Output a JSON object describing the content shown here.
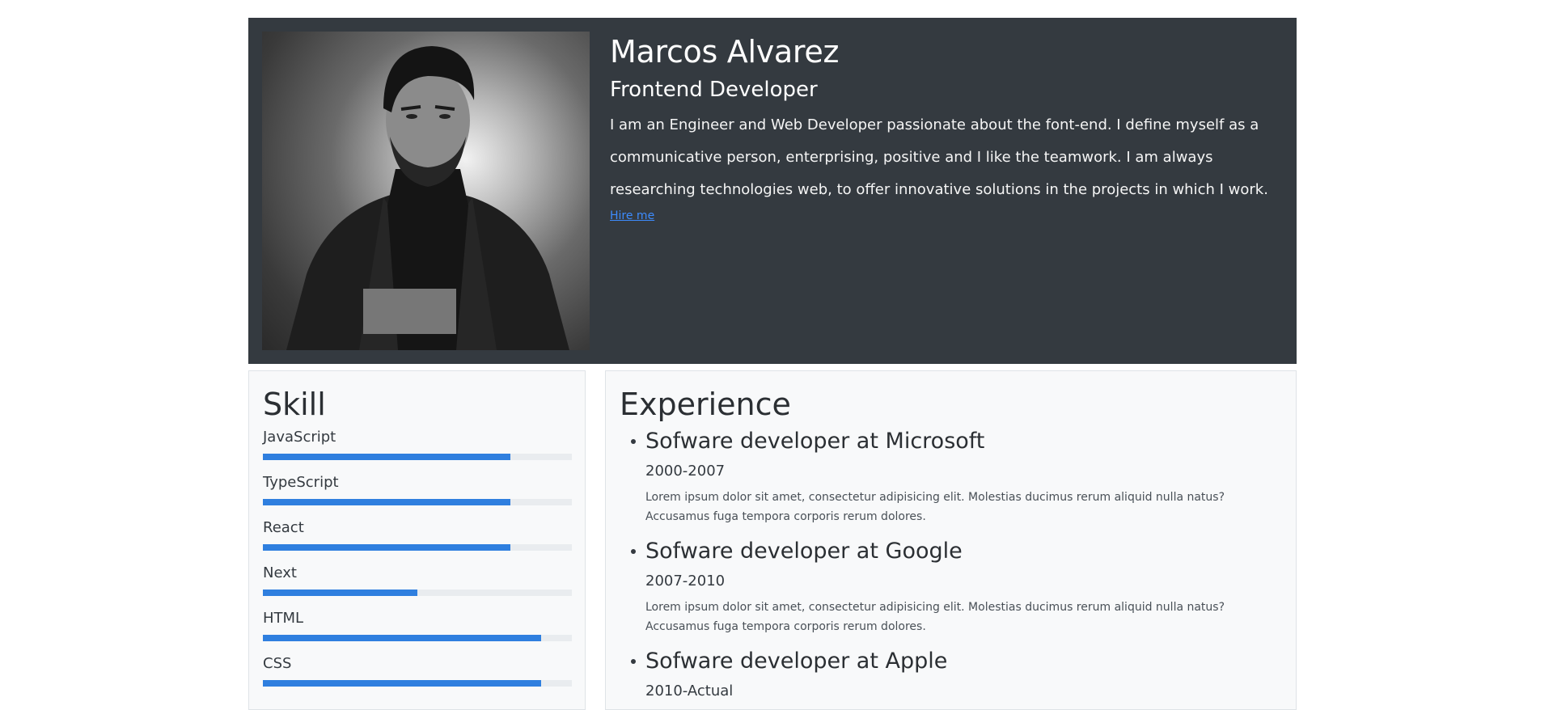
{
  "profile": {
    "name": "Marcos Alvarez",
    "role": "Frontend Developer",
    "bio": "I am an Engineer and Web Developer passionate about the font-end. I define myself as a communicative person, enterprising, positive and I like the teamwork. I am always researching technologies web, to offer innovative solutions in the projects in which I work.",
    "hire_label": "Hire me",
    "photo_alt": "Portrait photo"
  },
  "skills": {
    "title": "Skill",
    "items": [
      {
        "label": "JavaScript",
        "level": 0.8
      },
      {
        "label": "TypeScript",
        "level": 0.8
      },
      {
        "label": "React",
        "level": 0.8
      },
      {
        "label": "Next",
        "level": 0.5
      },
      {
        "label": "HTML",
        "level": 0.9
      },
      {
        "label": "CSS",
        "level": 0.9
      }
    ]
  },
  "experience": {
    "title": "Experience",
    "items": [
      {
        "title": "Sofware developer at Microsoft",
        "years": "2000-2007",
        "desc": "Lorem ipsum dolor sit amet, consectetur adipisicing elit. Molestias ducimus rerum aliquid nulla natus? Accusamus fuga tempora corporis rerum dolores."
      },
      {
        "title": "Sofware developer at Google",
        "years": "2007-2010",
        "desc": "Lorem ipsum dolor sit amet, consectetur adipisicing elit. Molestias ducimus rerum aliquid nulla natus? Accusamus fuga tempora corporis rerum dolores."
      },
      {
        "title": "Sofware developer at Apple",
        "years": "2010-Actual",
        "desc": ""
      }
    ]
  },
  "colors": {
    "header_bg": "#343a40",
    "link": "#3d8bfd",
    "bar_fill": "#2f7fdf",
    "bar_track": "#e9ecef",
    "card_bg": "#f8f9fa"
  }
}
